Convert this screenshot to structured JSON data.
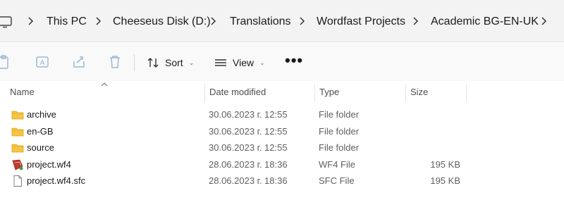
{
  "breadcrumbs": [
    "This PC",
    "Cheeseus Disk (D:)",
    "Translations",
    "Wordfast Projects",
    "Academic BG-EN-UK"
  ],
  "toolbar": {
    "sort_label": "Sort",
    "view_label": "View",
    "more_label": "•••"
  },
  "columns": {
    "name": "Name",
    "date": "Date modified",
    "type": "Type",
    "size": "Size"
  },
  "files": [
    {
      "name": "archive",
      "date": "30.06.2023 г. 12:55",
      "type": "File folder",
      "size": "",
      "icon": "folder-icon"
    },
    {
      "name": "en-GB",
      "date": "30.06.2023 г. 12:55",
      "type": "File folder",
      "size": "",
      "icon": "folder-icon"
    },
    {
      "name": "source",
      "date": "30.06.2023 г. 12:55",
      "type": "File folder",
      "size": "",
      "icon": "folder-icon"
    },
    {
      "name": "project.wf4",
      "date": "28.06.2023 г. 18:36",
      "type": "WF4 File",
      "size": "195 KB",
      "icon": "wordfast-file-icon"
    },
    {
      "name": "project.wf4.sfc",
      "date": "28.06.2023 г. 18:36",
      "type": "SFC File",
      "size": "195 KB",
      "icon": "blank-file-icon"
    }
  ],
  "colors": {
    "folder": "#f4c542",
    "accent_disabled": "#9bb8d6"
  }
}
